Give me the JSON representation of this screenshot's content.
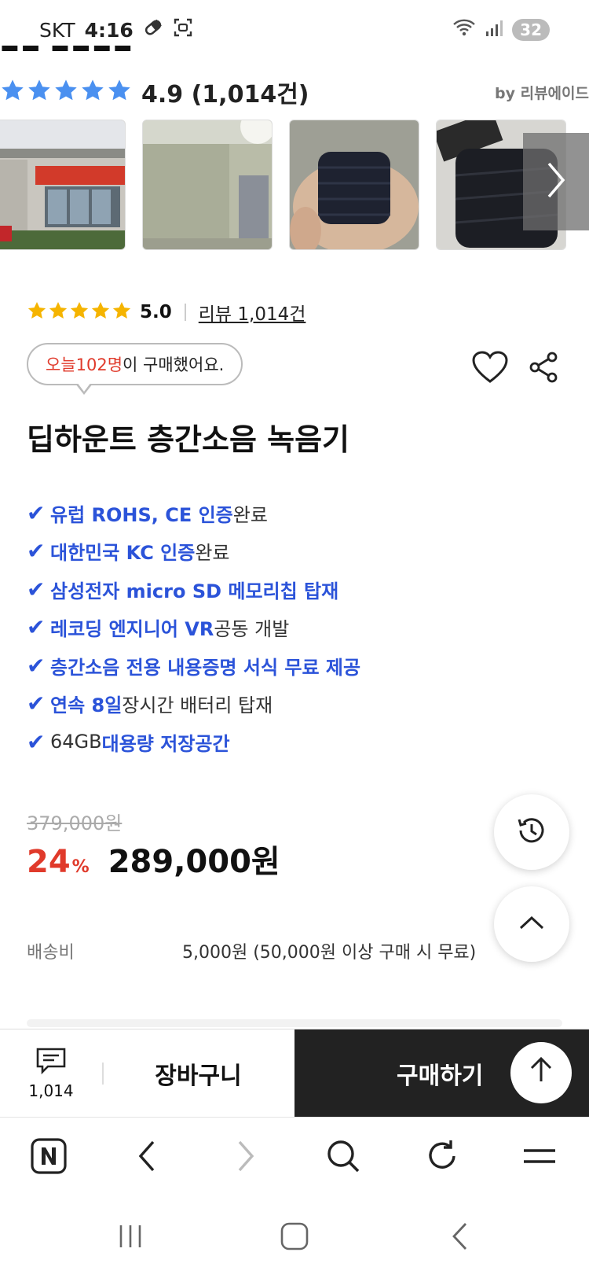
{
  "status_bar": {
    "carrier": "SKT",
    "time": "4:16",
    "battery": "32"
  },
  "review_summary": {
    "rating_text": "4.9 (1,014건)",
    "provider": "by 리뷰에이드",
    "stars": 5
  },
  "product": {
    "score": "5.0",
    "review_link": "리뷰 1,014건",
    "bubble": {
      "pre": "오늘 ",
      "count": "102명",
      "post": "이 구매했어요."
    },
    "title": "딥하운트 층간소음 녹음기",
    "features": [
      {
        "check": "✔",
        "bold": "유럽 ROHS, CE 인증",
        "plain": " 완료"
      },
      {
        "check": "✔",
        "bold": "대한민국 KC 인증",
        "plain": " 완료"
      },
      {
        "check": "✔",
        "bold": "삼성전자 micro SD 메모리칩 탑재",
        "plain": ""
      },
      {
        "check": "✔",
        "bold": "레코딩 엔지니어 VR",
        "plain": " 공동 개발"
      },
      {
        "check": "✔",
        "bold": "층간소음 전용 내용증명 서식 무료 제공",
        "plain": ""
      },
      {
        "check": "✔",
        "bold": "연속 8일",
        "plain": " 장시간 배터리 탑재"
      },
      {
        "check": "✔",
        "plain_first": "64GB ",
        "bold_last": "대용량 저장공간"
      }
    ],
    "original_price": "379,000원",
    "discount": "24",
    "discount_unit": "%",
    "final_price": "289,000원",
    "shipping_label": "배송비",
    "shipping_value": "5,000원 (50,000원 이상 구매 시 무료)"
  },
  "buy_bar": {
    "review_count": "1,014",
    "cart": "장바구니",
    "buy": "구매하기"
  },
  "colors": {
    "accent_blue": "#2b53d9",
    "sale_red": "#e03a2b",
    "star_blue": "#4a90f0",
    "star_yellow": "#f5b400",
    "buy_bg": "#222222"
  }
}
